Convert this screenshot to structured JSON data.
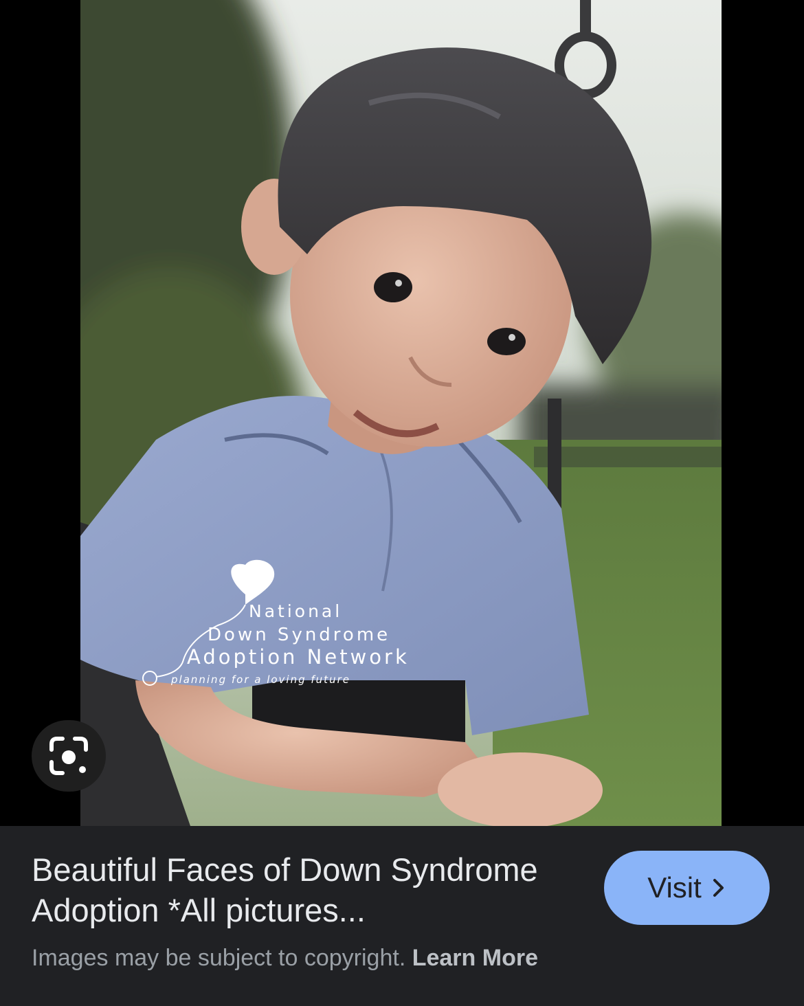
{
  "image": {
    "watermark_lines": [
      "National",
      "Down Syndrome",
      "Adoption Network",
      "planning for a loving future"
    ]
  },
  "lens": {
    "icon": "google-lens-icon"
  },
  "result": {
    "title": "Beautiful Faces of Down Syndrome Adoption *All pictures...",
    "visit_label": "Visit",
    "visit_icon": "chevron-right-icon",
    "copyright_text": "Images may be subject to copyright.",
    "learn_more_label": "Learn More"
  },
  "colors": {
    "panel_background": "#202124",
    "visit_button": "#8ab4f8",
    "title_text": "#e8eaed",
    "secondary_text": "#9aa0a6"
  }
}
